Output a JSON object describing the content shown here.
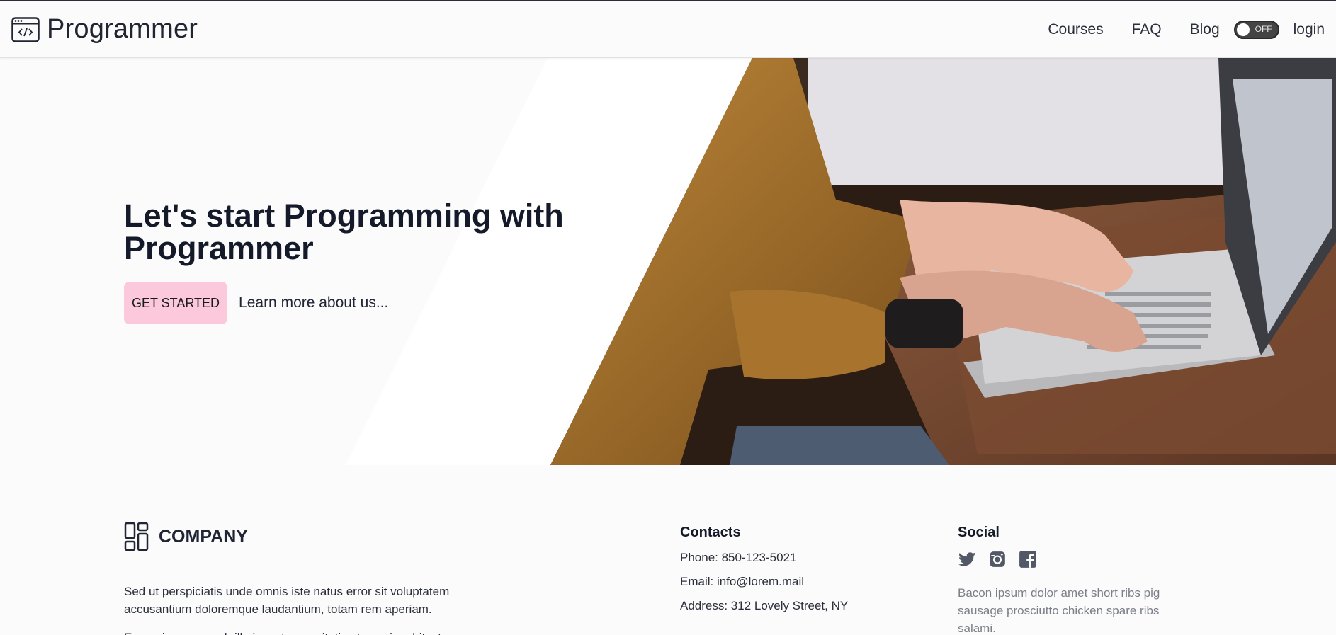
{
  "header": {
    "brand_icon": "code-window-icon",
    "brand_name": "Programmer",
    "nav": {
      "courses": "Courses",
      "faq": "FAQ",
      "blog": "Blog",
      "toggle_state": "OFF",
      "login": "login"
    }
  },
  "hero": {
    "title_line1": "Let's start Programming with",
    "title_line2": "Programmer",
    "primary_button": "GET STARTED",
    "secondary_link": "Learn more about us...",
    "image_subject": "person typing on laptop",
    "button_color": "#fbc8dc"
  },
  "footer": {
    "company": {
      "icon": "dashboard-layout-icon",
      "name": "COMPANY",
      "paragraph1": "Sed ut perspiciatis unde omnis iste natus error sit voluptatem accusantium doloremque laudantium, totam rem aperiam.",
      "paragraph2": "Eaque ipsa quae ab illo inventore veritatis et quasi architecto"
    },
    "contacts": {
      "heading": "Contacts",
      "phone": "Phone: 850-123-5021",
      "email": "Email: info@lorem.mail",
      "address": "Address: 312 Lovely Street, NY"
    },
    "social": {
      "heading": "Social",
      "icons": [
        "twitter-icon",
        "instagram-icon",
        "facebook-icon"
      ],
      "text": "Bacon ipsum dolor amet short ribs pig sausage prosciutto chicken spare ribs salami."
    }
  }
}
